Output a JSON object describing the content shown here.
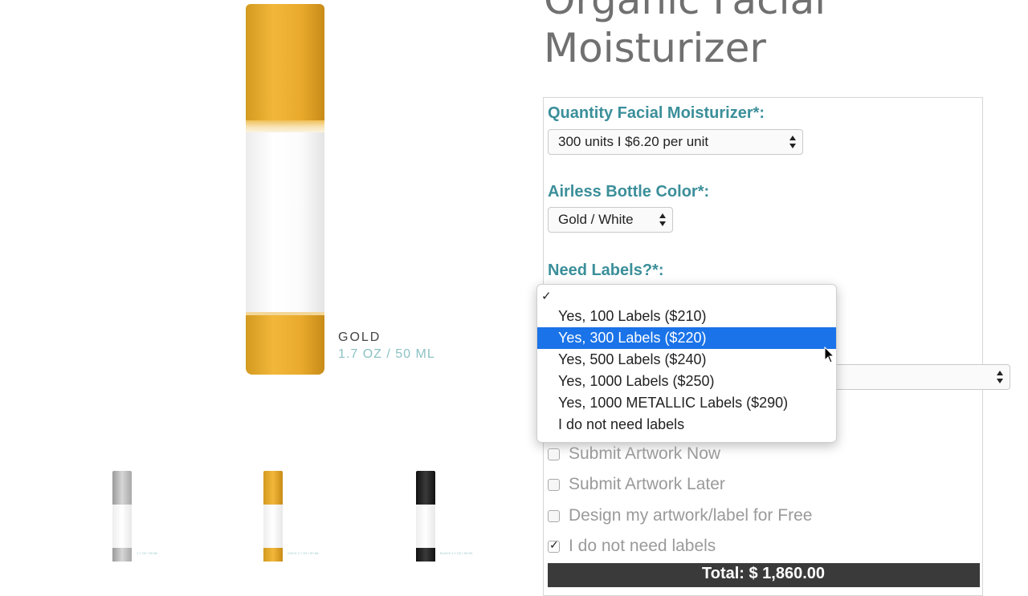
{
  "product": {
    "title": "Organic Facial Moisturizer",
    "variant_name": "GOLD",
    "variant_size": "1.7 OZ / 50 ML",
    "thumbnails": [
      {
        "color": "silver",
        "caption": "1.7 OZ / 50 ML"
      },
      {
        "color": "gold",
        "caption": "GOLD  1.7 OZ / 50 ML"
      },
      {
        "color": "black",
        "caption": "BLACK  1.7 OZ / 50 ML"
      }
    ]
  },
  "form": {
    "quantity_label": "Quantity Facial Moisturizer*:",
    "quantity_value": "300 units I $6.20 per unit",
    "color_label": "Airless Bottle Color*:",
    "color_value": "Gold / White",
    "labels_label": "Need Labels?*:",
    "labels_dropdown": {
      "check_mark": "✓",
      "options": [
        "",
        "Yes, 100 Labels ($210)",
        "Yes, 300 Labels ($220)",
        "Yes, 500 Labels ($240)",
        "Yes, 1000 Labels ($250)",
        "Yes, 1000 METALLIC Labels ($290)",
        "I do not need labels"
      ],
      "highlighted_index": 2,
      "highlight_color": "#1a73e8"
    },
    "artwork_options": [
      {
        "label": "Submit Artwork Now",
        "checked": false
      },
      {
        "label": "Submit Artwork Later",
        "checked": false
      },
      {
        "label": "Design my artwork/label for Free",
        "checked": false
      },
      {
        "label": "I do not need labels",
        "checked": true
      }
    ],
    "total_text": "Total:  $ 1,860.00"
  },
  "colors": {
    "label_teal": "#3b8f9a",
    "title_gray": "#707070",
    "gold": "#f2b73a"
  }
}
